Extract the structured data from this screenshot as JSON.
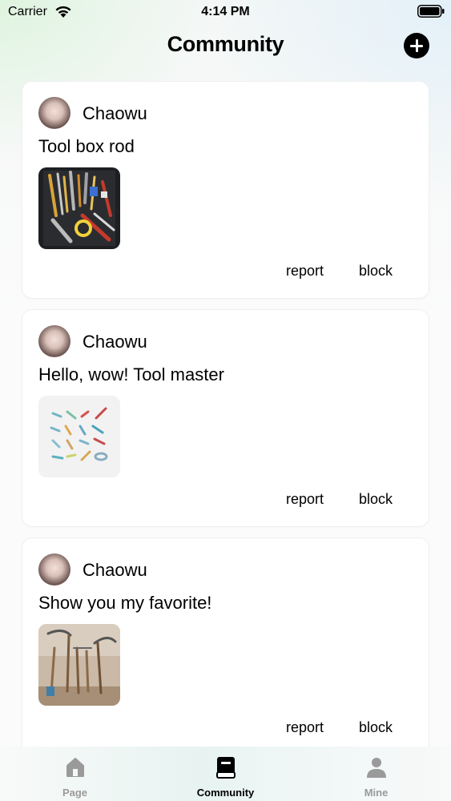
{
  "status_bar": {
    "carrier": "Carrier",
    "time": "4:14 PM"
  },
  "nav": {
    "title": "Community",
    "add_icon": "plus-circle-icon"
  },
  "posts": [
    {
      "username": "Chaowu",
      "text": "Tool box rod",
      "image": "toolbox-photo",
      "report_label": "report",
      "block_label": "block"
    },
    {
      "username": "Chaowu",
      "text": "Hello, wow! Tool master",
      "image": "tools-illustration",
      "report_label": "report",
      "block_label": "block"
    },
    {
      "username": "Chaowu",
      "text": "Show you my favorite!",
      "image": "garden-tools-photo",
      "report_label": "report",
      "block_label": "block"
    }
  ],
  "tab_bar": {
    "tabs": [
      {
        "label": "Page",
        "icon": "house-icon",
        "active": false
      },
      {
        "label": "Community",
        "icon": "book-icon",
        "active": true
      },
      {
        "label": "Mine",
        "icon": "person-icon",
        "active": false
      }
    ]
  },
  "colors": {
    "active_tab": "#000000",
    "inactive_tab": "#9a9a9a",
    "card_background": "#ffffff"
  }
}
